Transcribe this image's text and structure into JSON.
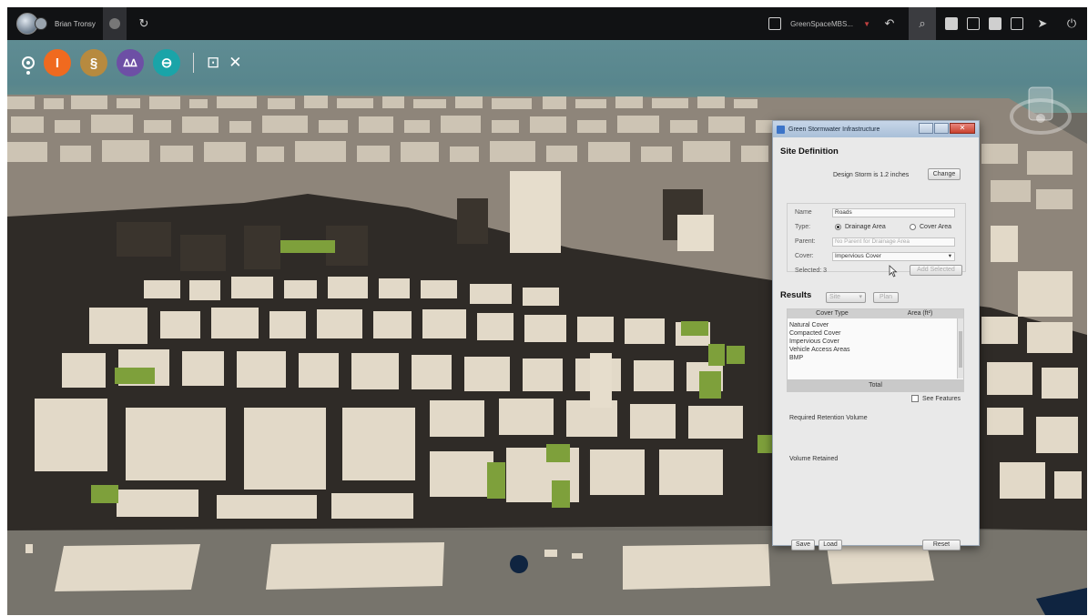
{
  "topbar": {
    "user_name": "Brian Tronsy",
    "model_name": "GreenSpaceMBS...",
    "icons": [
      "user-avatar-icon",
      "refresh-icon",
      "model-icon",
      "caret-down-icon",
      "undo-icon",
      "search-icon",
      "storyboard-icon",
      "bookmark-icon",
      "settings-icon",
      "layers-icon",
      "pointer-icon",
      "help-icon"
    ]
  },
  "toolbar": {
    "tools": [
      {
        "name": "selection-tool-icon",
        "color": "#ffffff"
      },
      {
        "name": "infrastructure-tool-icon",
        "color": "#f06a1f"
      },
      {
        "name": "analyze-tool-icon",
        "color": "#b78a3f"
      },
      {
        "name": "build-tool-icon",
        "color": "#6d4fa5"
      },
      {
        "name": "present-tool-icon",
        "color": "#1aa4a8"
      }
    ],
    "extra_icons": [
      "screen-icon",
      "tools-icon"
    ],
    "glyphs": {
      "infra": "I",
      "analyze": "§",
      "build": "ᐃᐃ",
      "present": "⊖",
      "screen": "⊡",
      "tools": "✕"
    }
  },
  "dialog": {
    "title": "Green Stormwater Infrastructure",
    "site_definition": {
      "heading": "Site Definition",
      "design_storm": "Design Storm is 1.2 inches",
      "change_label": "Change",
      "name_label": "Name",
      "name_value": "Roads",
      "type_label": "Type:",
      "type_options": [
        "Drainage Area",
        "Cover Area"
      ],
      "type_selected": "Drainage Area",
      "parent_label": "Parent:",
      "parent_placeholder": "No Parent for Drainage Area",
      "cover_label": "Cover:",
      "cover_value": "Impervious Cover",
      "selected_label": "Selected: 3",
      "add_selected_label": "Add Selected"
    },
    "results": {
      "heading": "Results",
      "site_select": "Site",
      "plan_label": "Plan",
      "columns": [
        "Cover Type",
        "Area (ft²)"
      ],
      "rows": [
        "Natural Cover",
        "Compacted Cover",
        "Impervious Cover",
        "Vehicle Access Areas",
        "BMP"
      ],
      "total_label": "Total",
      "see_features": "See Features",
      "required_retention": "Required Retention Volume",
      "volume_retained": "Volume Retained"
    },
    "buttons": {
      "save": "Save",
      "load": "Load",
      "reset": "Reset"
    }
  },
  "colors": {
    "water": "#5f8c93",
    "roads": "#2f2b27",
    "buildings": "#e2d9c8",
    "parks": "#7ea03b",
    "ground": "#6f6b63"
  }
}
